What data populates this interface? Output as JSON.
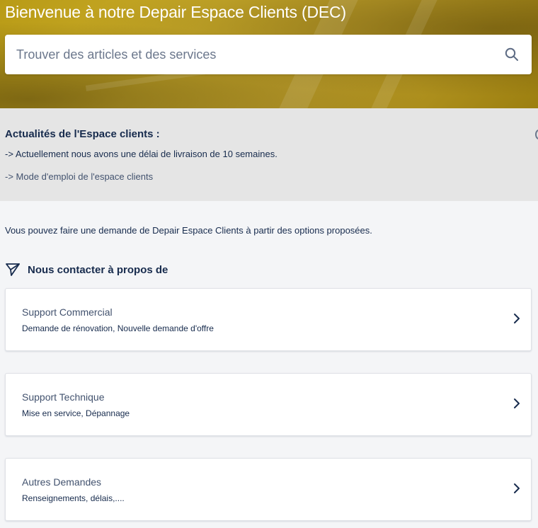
{
  "hero": {
    "title": "Bienvenue à notre Depair Espace Clients (DEC)"
  },
  "search": {
    "placeholder": "Trouver des articles et des services",
    "icon": "search-icon"
  },
  "announcements": {
    "title": "Actualités de l'Espace clients :",
    "line1": "-> Actuellement nous avons une délai de livraison de 10 semaines.",
    "line2": "-> Mode d'emploi de l'espace clients"
  },
  "intro": "Vous pouvez faire une demande de Depair Espace Clients à partir des options proposées.",
  "contact": {
    "icon": "send-icon",
    "title": "Nous contacter à propos de",
    "cards": [
      {
        "title": "Support Commercial",
        "description": "Demande de rénovation, Nouvelle demande d'offre"
      },
      {
        "title": "Support Technique",
        "description": "Mise en service, Dépannage"
      },
      {
        "title": "Autres Demandes",
        "description": "Renseignements, délais,...."
      }
    ]
  },
  "colors": {
    "banner": "#c2a324",
    "text_primary": "#172b4d",
    "text_secondary": "#42526e",
    "announce_bg": "#e5e5e5",
    "page_bg": "#f4f5f7"
  }
}
